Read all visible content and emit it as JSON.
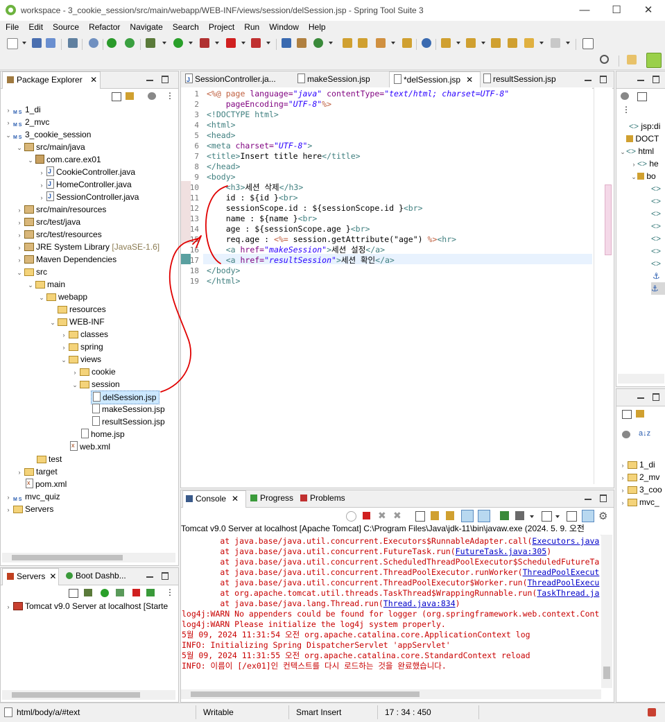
{
  "window": {
    "title": "workspace - 3_cookie_session/src/main/webapp/WEB-INF/views/session/delSession.jsp - Spring Tool Suite 3",
    "minimize": "—",
    "maximize": "☐",
    "close": "✕"
  },
  "menu": [
    "File",
    "Edit",
    "Source",
    "Refactor",
    "Navigate",
    "Search",
    "Project",
    "Run",
    "Window",
    "Help"
  ],
  "package_explorer": {
    "title": "Package Explorer",
    "items": [
      {
        "label": "1_di",
        "icon": "maven-project-icon"
      },
      {
        "label": "2_mvc",
        "icon": "maven-project-icon"
      },
      {
        "label": "3_cookie_session",
        "icon": "maven-project-icon"
      },
      {
        "label": "src/main/java",
        "icon": "source-folder-icon"
      },
      {
        "label": "com.care.ex01",
        "icon": "package-icon"
      },
      {
        "label": "CookieController.java",
        "icon": "java-file-icon"
      },
      {
        "label": "HomeController.java",
        "icon": "java-file-icon"
      },
      {
        "label": "SessionController.java",
        "icon": "java-file-icon"
      },
      {
        "label": "src/main/resources",
        "icon": "source-folder-icon"
      },
      {
        "label": "src/test/java",
        "icon": "source-folder-icon"
      },
      {
        "label": "src/test/resources",
        "icon": "source-folder-icon"
      },
      {
        "label": "JRE System Library",
        "suffix": "[JavaSE-1.6]",
        "icon": "library-icon"
      },
      {
        "label": "Maven Dependencies",
        "icon": "library-icon"
      },
      {
        "label": "src",
        "icon": "folder-icon"
      },
      {
        "label": "main",
        "icon": "folder-icon"
      },
      {
        "label": "webapp",
        "icon": "folder-icon"
      },
      {
        "label": "resources",
        "icon": "folder-icon"
      },
      {
        "label": "WEB-INF",
        "icon": "folder-icon"
      },
      {
        "label": "classes",
        "icon": "folder-icon"
      },
      {
        "label": "spring",
        "icon": "folder-icon"
      },
      {
        "label": "views",
        "icon": "folder-icon"
      },
      {
        "label": "cookie",
        "icon": "folder-icon"
      },
      {
        "label": "session",
        "icon": "folder-icon"
      },
      {
        "label": "delSession.jsp",
        "icon": "jsp-file-icon"
      },
      {
        "label": "makeSession.jsp",
        "icon": "jsp-file-icon"
      },
      {
        "label": "resultSession.jsp",
        "icon": "jsp-file-icon"
      },
      {
        "label": "home.jsp",
        "icon": "jsp-file-icon"
      },
      {
        "label": "web.xml",
        "icon": "xml-file-icon"
      },
      {
        "label": "test",
        "icon": "folder-icon"
      },
      {
        "label": "target",
        "icon": "folder-icon"
      },
      {
        "label": "pom.xml",
        "icon": "xml-file-icon"
      },
      {
        "label": "mvc_quiz",
        "icon": "maven-project-icon"
      },
      {
        "label": "Servers",
        "icon": "folder-icon"
      }
    ]
  },
  "servers_panel": {
    "tab_servers": "Servers",
    "tab_boot": "Boot Dashb...",
    "server_label": "Tomcat v9.0 Server at localhost",
    "server_state": "[Starte"
  },
  "editor": {
    "tabs": [
      "SessionController.ja...",
      "makeSession.jsp",
      "*delSession.jsp",
      "resultSession.jsp"
    ],
    "active_tab": "*delSession.jsp",
    "lines": [
      "1",
      "2",
      "3",
      "4",
      "5",
      "6",
      "7",
      "8",
      "9",
      "10",
      "11",
      "12",
      "13",
      "14",
      "15",
      "16",
      "17",
      "18",
      "19"
    ],
    "code": {
      "l1a": "<%@",
      "l1b": " page ",
      "l1c": "language=",
      "l1d": "\"java\"",
      "l1e": " contentType=",
      "l1f": "\"text/html; charset=UTF-8\"",
      "l2a": "    pageEncoding=",
      "l2b": "\"UTF-8\"",
      "l2c": "%>",
      "l3": "<!DOCTYPE html>",
      "l4": "<html>",
      "l5": "<head>",
      "l6a": "<meta ",
      "l6b": "charset=",
      "l6c": "\"UTF-8\"",
      "l6d": ">",
      "l7a": "<title>",
      "l7b": "Insert title here",
      "l7c": "</title>",
      "l8": "</head>",
      "l9": "<body>",
      "l10a": "    <h3>",
      "l10b": "세션 삭제",
      "l10c": "</h3>",
      "l11a": "    id : ${id }",
      "l11b": "<br>",
      "l12a": "    sessionScope.id : ${sessionScope.id }",
      "l12b": "<br>",
      "l13a": "    name : ${name }",
      "l13b": "<br>",
      "l14a": "    age : ${sessionScope.age }",
      "l14b": "<br>",
      "l15a": "    req.age : ",
      "l15b": "<%=",
      "l15c": " session.getAttribute(\"age\") ",
      "l15d": "%>",
      "l15e": "<hr>",
      "l16a": "    <a ",
      "l16b": "href=",
      "l16c": "\"makeSession\"",
      "l16d": ">",
      "l16e": "세션 설정",
      "l16f": "</a>",
      "l17a": "    <a ",
      "l17b": "href=",
      "l17c": "\"resultSession\"",
      "l17d": ">",
      "l17e": "세션 확인",
      "l17f": "</a>",
      "l18": "</body>",
      "l19": "</html>"
    }
  },
  "outline": {
    "items": [
      "jsp:di",
      "DOCT",
      "html",
      "he",
      "bo"
    ]
  },
  "bottom_right": {
    "items": [
      "1_di",
      "2_mv",
      "3_coo",
      "mvc_"
    ]
  },
  "console": {
    "tab_console": "Console",
    "tab_progress": "Progress",
    "tab_problems": "Problems",
    "header": "Tomcat v9.0 Server at localhost [Apache Tomcat] C:\\Program Files\\Java\\jdk-11\\bin\\javaw.exe  (2024. 5. 9. 오전",
    "lines": [
      {
        "t": "        at java.base/java.util.concurrent.Executors$RunnableAdapter.call(",
        "l": "Executors.java"
      },
      {
        "t": "        at java.base/java.util.concurrent.FutureTask.run(",
        "l": "FutureTask.java:305",
        "e": ")"
      },
      {
        "t": "        at java.base/java.util.concurrent.ScheduledThreadPoolExecutor$ScheduledFutureTa",
        "l": ""
      },
      {
        "t": "        at java.base/java.util.concurrent.ThreadPoolExecutor.runWorker(",
        "l": "ThreadPoolExecut"
      },
      {
        "t": "        at java.base/java.util.concurrent.ThreadPoolExecutor$Worker.run(",
        "l": "ThreadPoolExecu"
      },
      {
        "t": "        at org.apache.tomcat.util.threads.TaskThread$WrappingRunnable.run(",
        "l": "TaskThread.ja"
      },
      {
        "t": "        at java.base/java.lang.Thread.run(",
        "l": "Thread.java:834",
        "e": ")"
      },
      {
        "t": "log4j:WARN No appenders could be found for logger (org.springframework.web.context.Cont",
        "l": ""
      },
      {
        "t": "log4j:WARN Please initialize the log4j system properly.",
        "l": ""
      },
      {
        "t": "5월 09, 2024 11:31:54 오전 org.apache.catalina.core.ApplicationContext log",
        "l": ""
      },
      {
        "t": "INFO: Initializing Spring DispatcherServlet 'appServlet'",
        "l": ""
      },
      {
        "t": "5월 09, 2024 11:31:55 오전 org.apache.catalina.core.StandardContext reload",
        "l": ""
      },
      {
        "t": "INFO: 이름이 [/ex01]인 컨텍스트를 다시 로드하는 것을 완료했습니다.",
        "l": ""
      }
    ]
  },
  "status": {
    "path": "html/body/a/#text",
    "mode": "Writable",
    "insert": "Smart Insert",
    "position": "17 : 34 : 450"
  },
  "colors": {
    "annotation": "#e00000",
    "selection": "#cce8ff",
    "current_line": "#e8f2fe"
  }
}
